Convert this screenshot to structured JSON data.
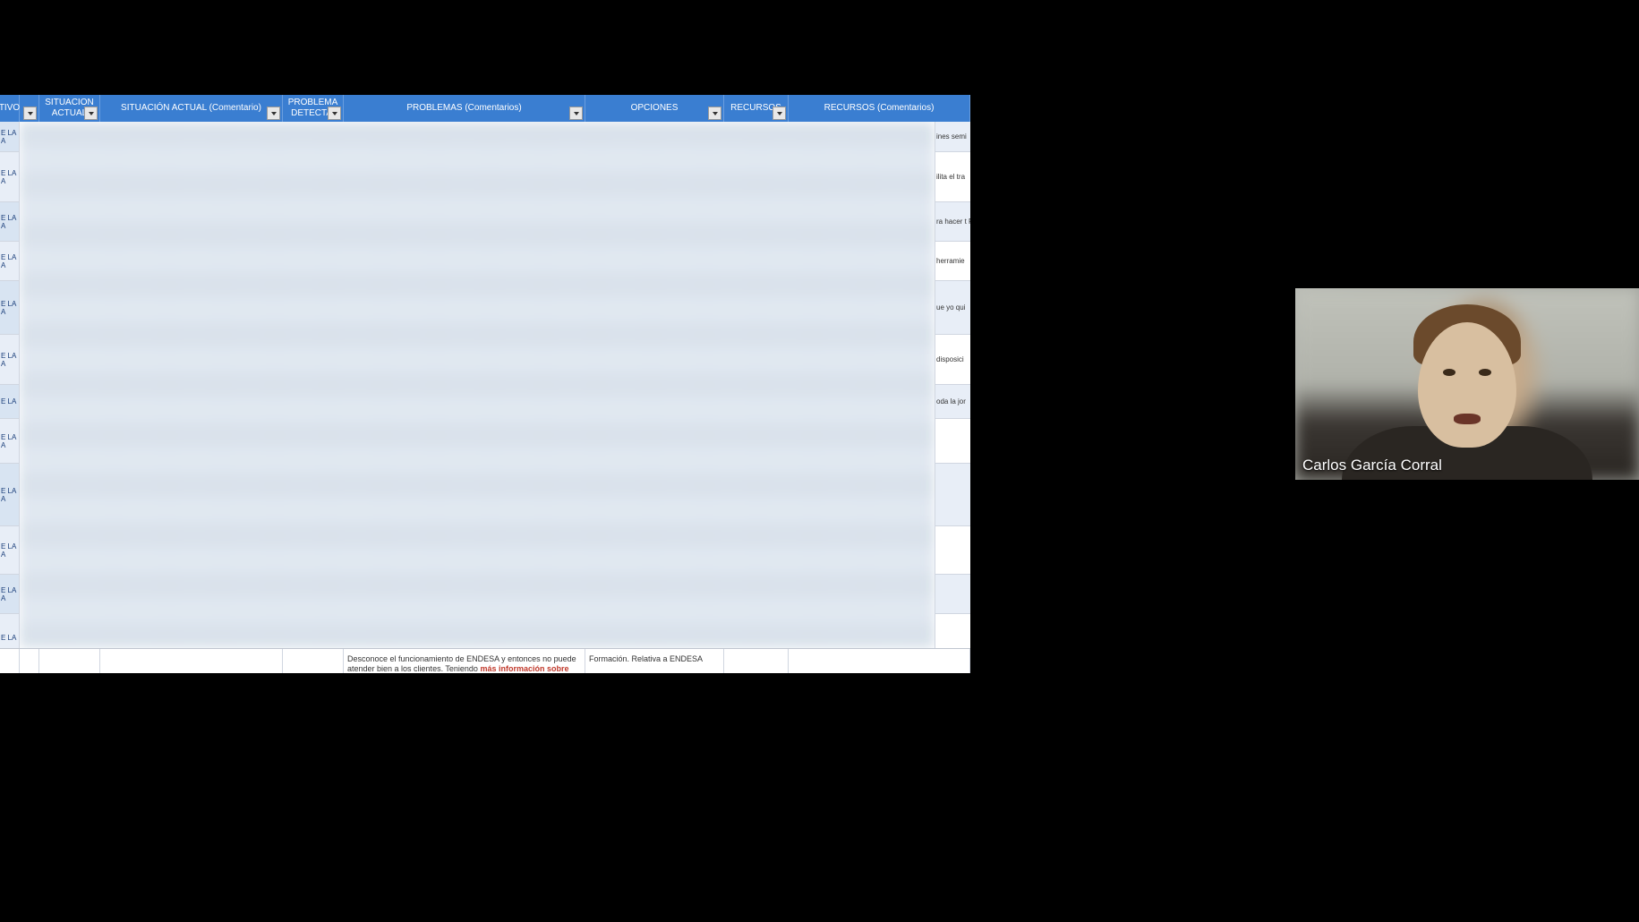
{
  "headers": {
    "col0": "TIVO",
    "col2_line1": "SITUACION",
    "col2_line2": "ACTUAL",
    "col3": "SITUACIÓN ACTUAL (Comentario)",
    "col4_line1": "PROBLEMA",
    "col4_line2": "DETECTAI",
    "col5": "PROBLEMAS (Comentarios)",
    "col6": "OPCIONES",
    "col7": "RECURSOS",
    "col8": "RECURSOS (Comentarios)"
  },
  "left_items": [
    "E LA A",
    "E LA A",
    "E LA A",
    "E LA A",
    "E LA A",
    "E LA A",
    "E LA",
    "E LA A",
    "E LA A",
    "E LA A",
    "E LA A",
    "E LA"
  ],
  "right_snippets": [
    "ines semi",
    "ilita el tra",
    "ra hacer t Recibe q",
    "herramie",
    "ue yo qui",
    "disposici",
    "oda la jor",
    "",
    "",
    "",
    "",
    ""
  ],
  "bottom_row": {
    "problemas_text_prefix": "Desconoce el funcionamiento de ENDESA y entonces no puede atender bien a los clientes. Teniendo ",
    "problemas_text_highlight": "más información sobre",
    "opciones_text": "Formación. Relativa a ENDESA"
  },
  "participant_name": "Carlos García Corral"
}
